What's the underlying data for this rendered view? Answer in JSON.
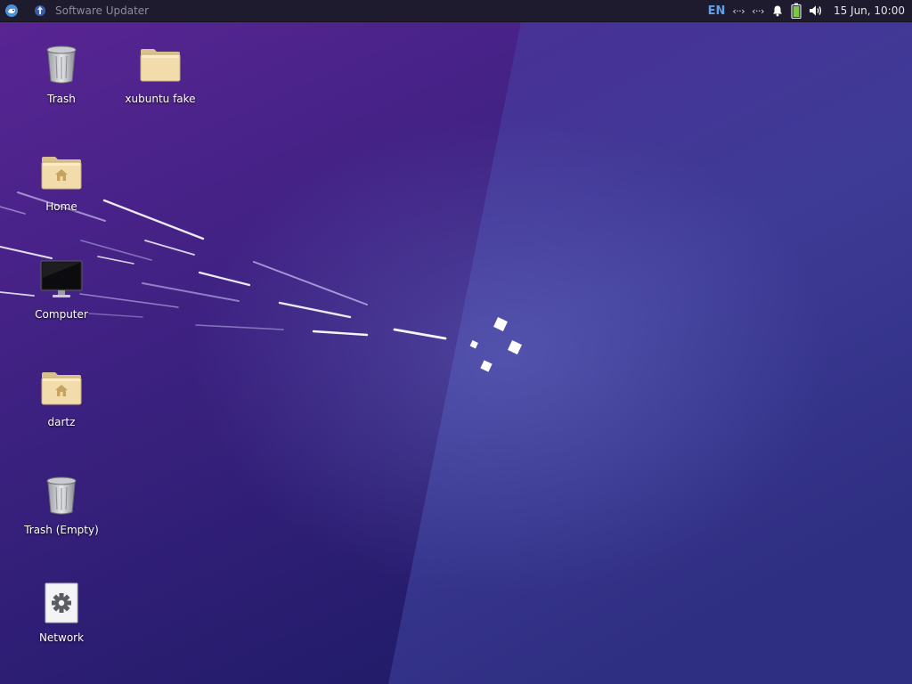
{
  "panel": {
    "task_title": "Software Updater",
    "keyboard_layout": "EN",
    "network_1": "‹··›",
    "network_2": "‹··›",
    "clock": "15 Jun, 10:00",
    "icons": [
      "whisker-menu-icon",
      "software-updater-icon",
      "network-icon",
      "notification-bell-icon",
      "battery-icon",
      "volume-icon"
    ]
  },
  "desktop": {
    "icons": [
      {
        "label": "Trash",
        "icon": "trash-icon"
      },
      {
        "label": "xubuntu fake",
        "icon": "folder-icon"
      },
      {
        "label": "Home",
        "icon": "home-folder-icon"
      },
      {
        "label": "Computer",
        "icon": "computer-icon"
      },
      {
        "label": "dartz",
        "icon": "home-folder-icon"
      },
      {
        "label": "Trash (Empty)",
        "icon": "trash-icon"
      },
      {
        "label": "Network",
        "icon": "network-settings-icon"
      }
    ]
  },
  "colors": {
    "panel_bg": "#1e1b2e",
    "wallpaper_top_left": "#5a2594",
    "wallpaper_bottom": "#201d6a",
    "accent": "#5fa0e6"
  }
}
